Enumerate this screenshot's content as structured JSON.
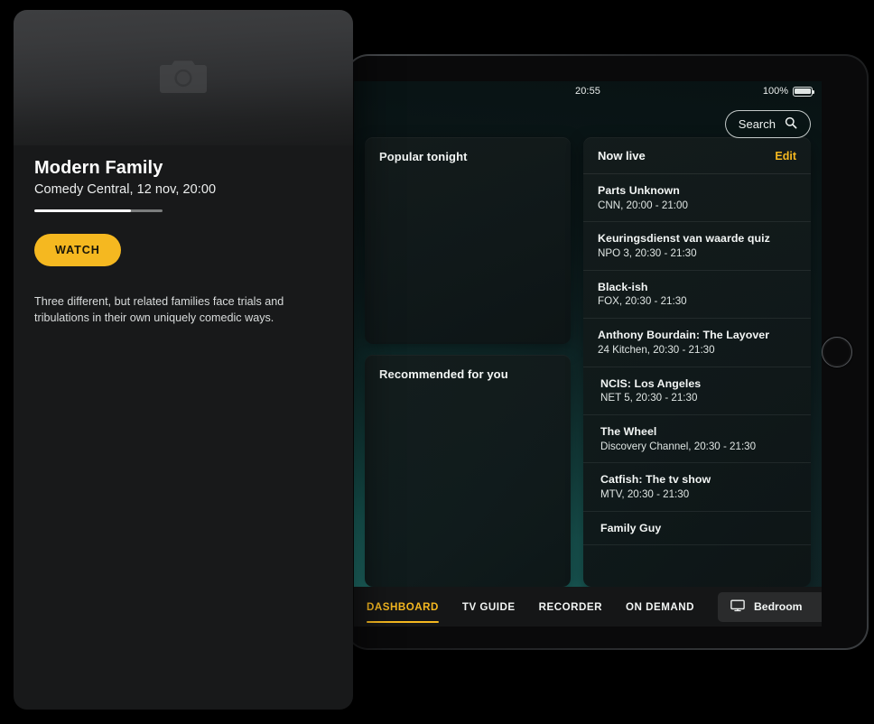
{
  "device": {
    "home_button": "home-button"
  },
  "status_bar": {
    "time": "20:55",
    "battery_percent": "100%"
  },
  "search": {
    "label": "Search",
    "icon": "search-icon"
  },
  "panels": {
    "popular": {
      "title": "Popular tonight"
    },
    "recommended": {
      "title": "Recommended for you"
    }
  },
  "now_live": {
    "title": "Now live",
    "edit_label": "Edit",
    "items": [
      {
        "name": "Parts Unknown",
        "meta": "CNN, 20:00 - 21:00"
      },
      {
        "name": "Keuringsdienst van waarde quiz",
        "meta": "NPO 3, 20:30 - 21:30"
      },
      {
        "name": "Black-ish",
        "meta": "FOX, 20:30 - 21:30"
      },
      {
        "name": "Anthony Bourdain: The Layover",
        "meta": "24 Kitchen, 20:30 - 21:30"
      },
      {
        "name": "NCIS: Los Angeles",
        "meta": "NET 5, 20:30 - 21:30"
      },
      {
        "name": "The Wheel",
        "meta": "Discovery Channel, 20:30 - 21:30"
      },
      {
        "name": "Catfish: The tv show",
        "meta": "MTV, 20:30 - 21:30"
      },
      {
        "name": "Family Guy",
        "meta": ""
      }
    ]
  },
  "bottom_nav": {
    "tabs": [
      {
        "label": "DASHBOARD",
        "active": true
      },
      {
        "label": "TV GUIDE",
        "active": false
      },
      {
        "label": "RECORDER",
        "active": false
      },
      {
        "label": "ON DEMAND",
        "active": false
      }
    ],
    "device_button": {
      "label": "Bedroom",
      "icon": "tv-monitor-icon"
    }
  },
  "detail_card": {
    "image_placeholder_icon": "camera-icon",
    "title": "Modern Family",
    "subtitle": "Comedy Central, 12 nov, 20:00",
    "progress_percent": 75,
    "watch_label": "WATCH",
    "description": "Three different, but related families face trials and tribulations in their own uniquely comedic ways."
  },
  "colors": {
    "accent_amber": "#f5b820",
    "accent_teal": "#1d6f6a",
    "card_dark": "#18191a"
  }
}
